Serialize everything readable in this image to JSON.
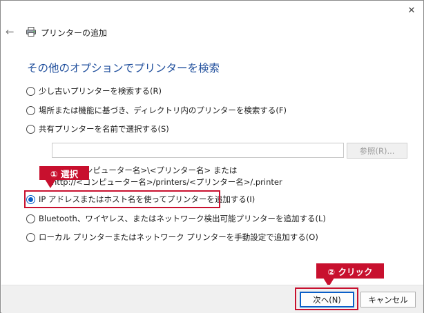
{
  "window": {
    "title": "プリンターの追加",
    "close_glyph": "✕",
    "back_glyph": "←"
  },
  "heading": "その他のオプションでプリンターを検索",
  "options": [
    {
      "label": "少し古いプリンターを検索する(R)",
      "checked": false
    },
    {
      "label": "場所または機能に基づき、ディレクトリ内のプリンターを検索する(F)",
      "checked": false
    },
    {
      "label": "共有プリンターを名前で選択する(S)",
      "checked": false
    },
    {
      "label": "IP アドレスまたはホスト名を使ってプリンターを追加する(I)",
      "checked": true
    },
    {
      "label": "Bluetooth、ワイヤレス、またはネットワーク検出可能プリンターを追加する(L)",
      "checked": false
    },
    {
      "label": "ローカル プリンターまたはネットワーク プリンターを手動設定で追加する(O)",
      "checked": false
    }
  ],
  "shared_printer": {
    "input_value": "",
    "browse_label": "参照(R)...",
    "example_line1": "例: \\\\<コンピューター名>\\<プリンター名> または",
    "example_line2": "http://<コンピューター名>/printers/<プリンター名>/.printer"
  },
  "annotations": {
    "step1": "① 選択",
    "step2": "② クリック",
    "color": "#c8102e"
  },
  "footer": {
    "next_label": "次へ(N)",
    "cancel_label": "キャンセル"
  },
  "colors": {
    "heading": "#1f4e9c",
    "accent": "#0a5fc8"
  },
  "icons": {
    "back": "back-arrow-icon",
    "printer": "printer-icon",
    "close": "close-icon"
  }
}
